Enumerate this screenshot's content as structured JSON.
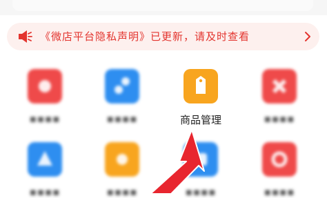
{
  "notice": {
    "text": "《微店平台隐私声明》已更新，请及时查看",
    "icon": "speaker-icon",
    "chevron": "chevron-right-icon",
    "color": "#e3342e",
    "background": "#fdf0ee"
  },
  "grid": {
    "row1": [
      {
        "label": "▪▪▪▪",
        "icon": "feature-icon",
        "color": "#ef4a4a",
        "obscured": true
      },
      {
        "label": "▪▪▪▪",
        "icon": "feature-icon",
        "color": "#2e8ef0",
        "obscured": true
      },
      {
        "label": "商品管理",
        "icon": "price-tag-icon",
        "color": "#f8a51f",
        "obscured": false
      },
      {
        "label": "▪▪▪▪",
        "icon": "feature-icon",
        "color": "#ef4a4a",
        "obscured": true
      }
    ],
    "row2": [
      {
        "label": "▪▪▪▪",
        "icon": "feature-icon",
        "color": "#2e8ef0",
        "obscured": true
      },
      {
        "label": "▪▪▪▪",
        "icon": "feature-icon",
        "color": "#f8a51f",
        "obscured": true
      },
      {
        "label": "▪▪▪▪",
        "icon": "feature-icon",
        "color": "#2e8ef0",
        "obscured": true
      },
      {
        "label": "▪▪▪▪",
        "icon": "feature-icon",
        "color": "#ef4a4a",
        "obscured": true
      }
    ]
  },
  "annotation": {
    "arrow_color": "#e8262f"
  }
}
